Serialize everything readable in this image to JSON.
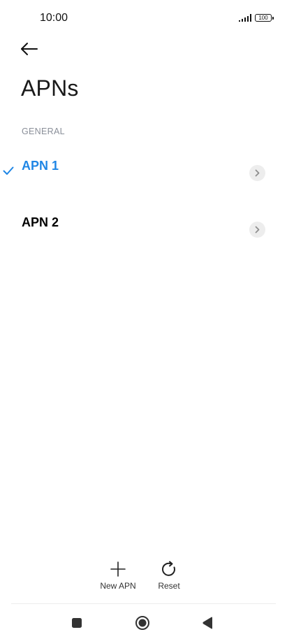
{
  "status_bar": {
    "time": "10:00",
    "battery": "100"
  },
  "header": {
    "back_icon": "arrow-left-icon",
    "title": "APNs"
  },
  "section": {
    "title": "GENERAL"
  },
  "apn_list": [
    {
      "label": "APN 1",
      "selected": true
    },
    {
      "label": "APN 2",
      "selected": false
    }
  ],
  "actions": {
    "new_apn_label": "New APN",
    "reset_label": "Reset"
  },
  "nav": {
    "recents_icon": "square-icon",
    "home_icon": "circle-icon",
    "back_icon": "triangle-back-icon"
  },
  "colors": {
    "accent": "#1f86e5",
    "section_header": "#8a8f99",
    "chevron_bg": "#ededed"
  }
}
